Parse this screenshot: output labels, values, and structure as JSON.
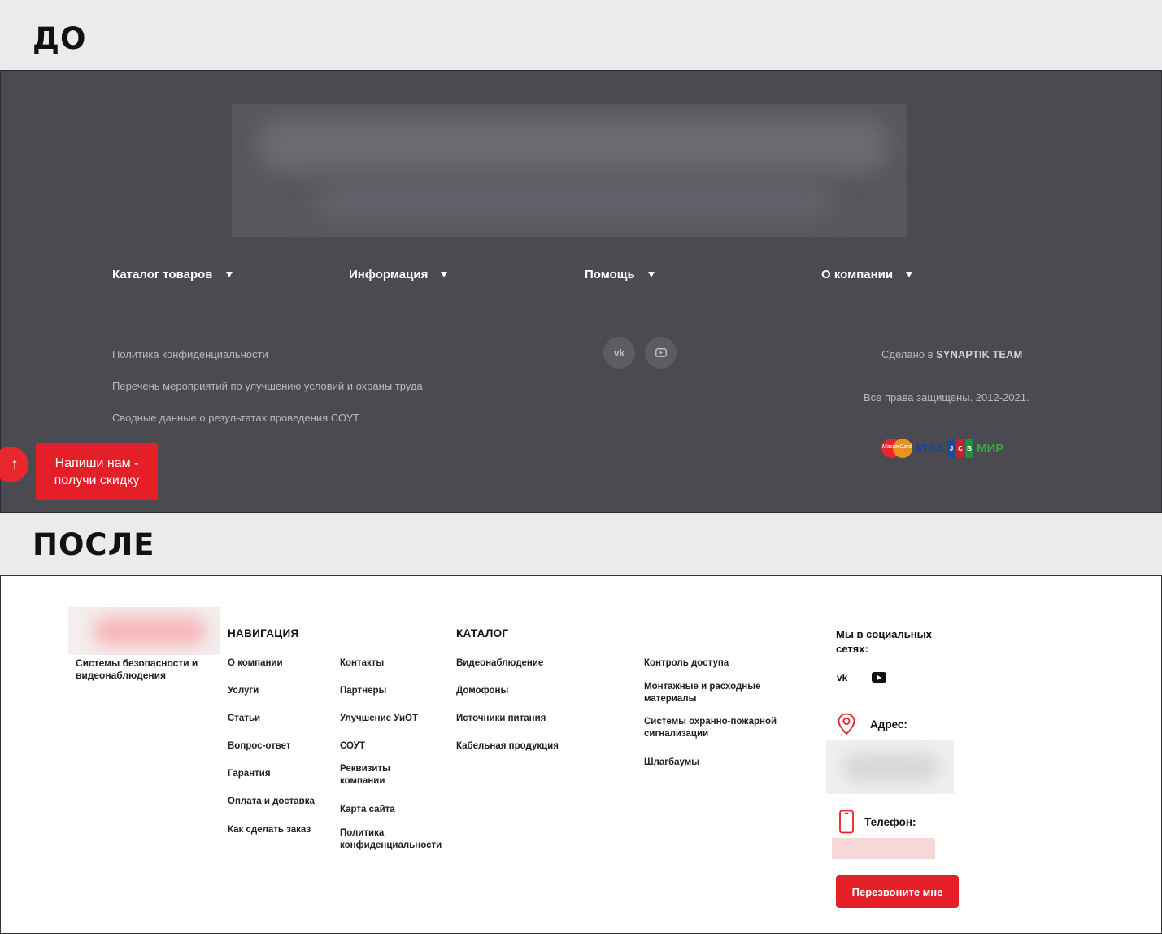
{
  "labels": {
    "before": "ДО",
    "after": "ПОСЛЕ"
  },
  "before": {
    "menu": [
      "Каталог товаров",
      "Информация",
      "Помощь",
      "О компании"
    ],
    "documents": [
      "Политика конфиденциальности",
      "Перечень мероприятий по улучшению условий и охраны труда",
      "Сводные данные о результатах проведения СОУТ"
    ],
    "social_icons": [
      "vk-icon",
      "youtube-icon"
    ],
    "credit_prefix": "Сделано в ",
    "credit_brand": "SYNAPTIK TEAM",
    "rights": "Все права защищены. 2012-2021.",
    "payments": {
      "mastercard": "MasterCard",
      "visa": "VISA",
      "jcb": [
        "J",
        "C",
        "B"
      ],
      "mir": "МИР"
    },
    "scroll_up": "↑",
    "write_button": "Напиши нам -\nполучи скидку"
  },
  "after": {
    "tagline": "Системы безопасности и видеонаблюдения",
    "nav_title": "НАВИГАЦИЯ",
    "nav_col1": [
      "О компании",
      "Услуги",
      "Статьи",
      "Вопрос-ответ",
      "Гарантия",
      "Оплата и доставка",
      "Как сделать заказ"
    ],
    "nav_col2": [
      "Контакты",
      "Партнеры",
      "Улучшение УиОТ",
      "СОУТ",
      "Реквизиты компании",
      "Карта сайта",
      "Политика конфиденциальности"
    ],
    "catalog_title": "КАТАЛОГ",
    "catalog_col1": [
      "Видеонаблюдение",
      "Домофоны",
      "Источники питания",
      "Кабельная продукция"
    ],
    "catalog_col2": [
      "Контроль доступа",
      "Монтажные и расходные материалы",
      "Системы охранно-пожарной сигнализации",
      "Шлагбаумы"
    ],
    "social_title": "Мы в социальных сетях:",
    "vk": "vk",
    "address_label": "Адрес:",
    "phone_label": "Телефон:",
    "callback_button": "Перезвоните мне"
  },
  "colors": {
    "accent": "#e51f28",
    "before_bg": "#4b4a51",
    "after_bg": "#ffffff"
  }
}
